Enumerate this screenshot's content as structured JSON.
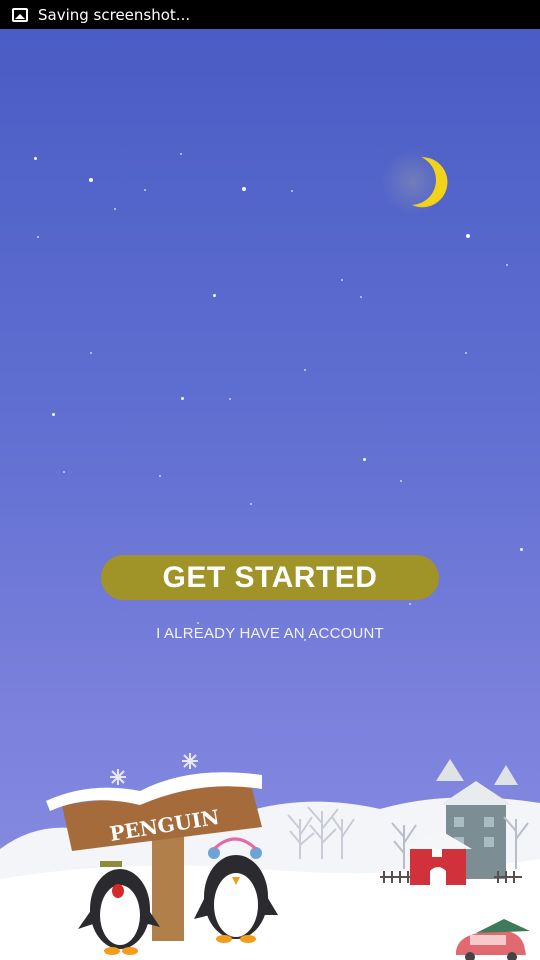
{
  "status_bar": {
    "icon": "image-icon",
    "notification": "Saving screenshot..."
  },
  "moon": {
    "color": "#f3d21a"
  },
  "actions": {
    "get_started": "GET STARTED",
    "have_account": "I ALREADY HAVE AN ACCOUNT"
  },
  "illustration": {
    "sign_text": "PENGUIN"
  },
  "colors": {
    "sky_top": "#4a5cc5",
    "sky_bottom": "#8b8ee2",
    "button": "#a09327"
  }
}
